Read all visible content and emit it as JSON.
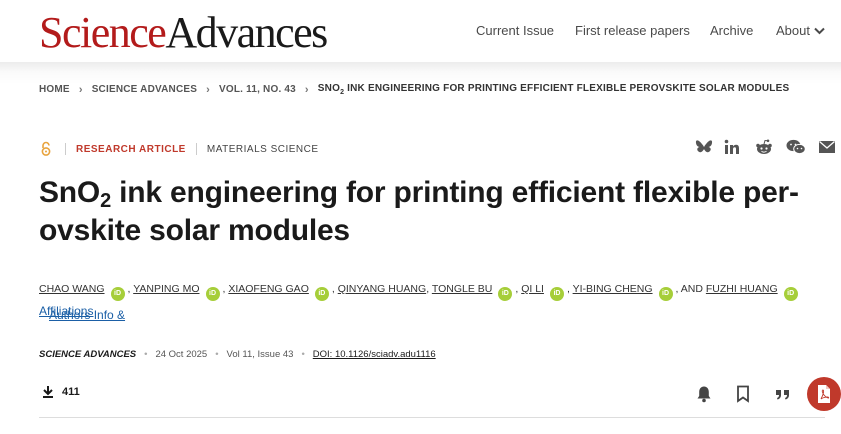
{
  "header": {
    "logo_science": "Science",
    "logo_advances": "Advances",
    "nav": {
      "current_issue": "Current Issue",
      "first_release": "First release papers",
      "archive": "Archive",
      "about": "About"
    }
  },
  "breadcrumb": {
    "home": "HOME",
    "journal": "SCIENCE ADVANCES",
    "volume": "VOL. 11, NO. 43",
    "current_pre": "SNO",
    "current_sub": "2",
    "current_post": " INK ENGINEERING FOR PRINTING EFFICIENT FLEXIBLE PEROVSKITE SOLAR MODULES"
  },
  "article": {
    "type": "RESEARCH ARTICLE",
    "subject": "MATERIALS SCIENCE",
    "title_pre": "SnO",
    "title_sub": "2",
    "title_post": " ink engineering for printing efficient flexible per-ovskite solar modules",
    "authors": [
      {
        "name": "CHAO WANG",
        "prefix": ""
      },
      {
        "name": "YANPING MO",
        "prefix": ", "
      },
      {
        "name": "XIAOFENG GAO",
        "prefix": ", "
      },
      {
        "name": "QINYANG HUANG",
        "prefix": ", "
      },
      {
        "name": "TONGLE BU",
        "prefix": ", "
      },
      {
        "name": "QI LI",
        "prefix": ", "
      },
      {
        "name": "YI-BING CHENG",
        "prefix": ", "
      },
      {
        "name": "FUZHI HUANG",
        "prefix": ", AND "
      }
    ],
    "orcid_label": "iD",
    "affiliations_line1": "Authors Info &",
    "affiliations_line2": "Affiliations"
  },
  "meta": {
    "journal": "SCIENCE ADVANCES",
    "date": "24 Oct 2025",
    "volume_issue": "Vol 11, Issue 43",
    "doi": "DOI: 10.1126/sciadv.adu1116"
  },
  "stats": {
    "downloads": "411"
  },
  "icons": {
    "open_access": "open-access-icon",
    "share": [
      "bluesky-icon",
      "linkedin-icon",
      "reddit-icon",
      "wechat-icon",
      "email-icon"
    ],
    "actions": [
      "bell-icon",
      "bookmark-icon",
      "quote-icon",
      "pdf-icon"
    ]
  },
  "colors": {
    "brand_red": "#b31b1b",
    "link_blue": "#1b5fa6",
    "orcid_green": "#a6ce39",
    "accent_orange": "#e8a33d"
  }
}
